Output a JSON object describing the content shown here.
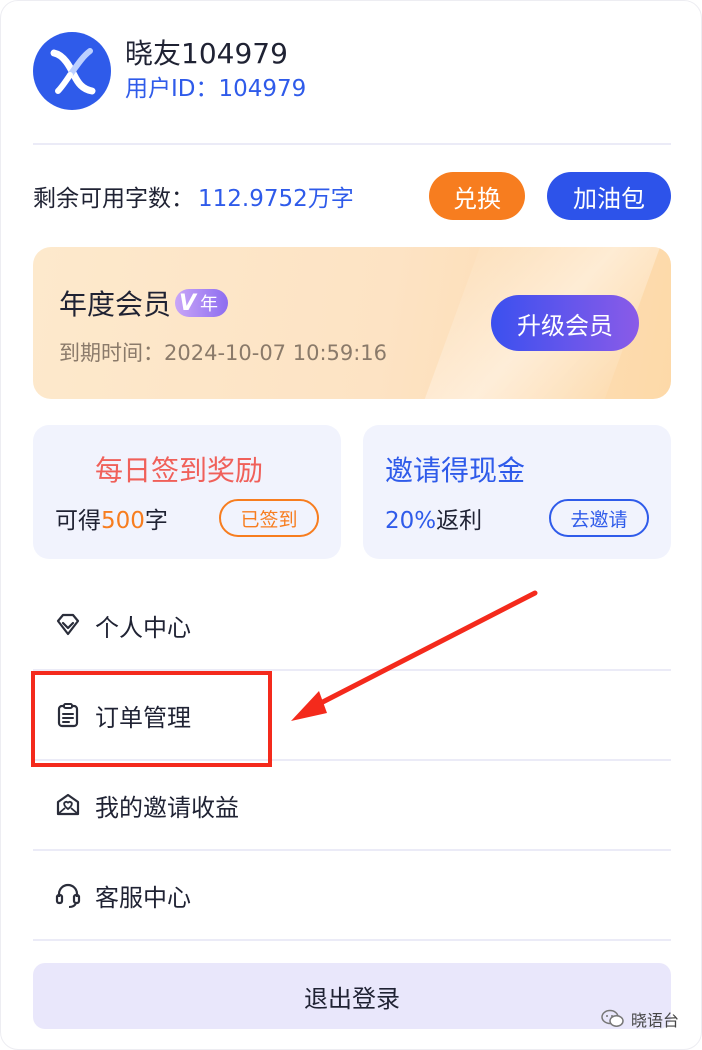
{
  "user": {
    "name": "晓友104979",
    "id_text": "用户ID：104979"
  },
  "balance": {
    "label": "剩余可用字数：",
    "value": "112.9752万字",
    "redeem_label": "兑换",
    "topup_label": "加油包"
  },
  "membership": {
    "title": "年度会员",
    "badge_v": "V",
    "badge_text": "年",
    "expire": "到期时间：2024-10-07 10:59:16",
    "upgrade_label": "升级会员"
  },
  "checkin": {
    "title": "每日签到奖励",
    "sub_prefix": "可得",
    "sub_amount": "500",
    "sub_suffix": "字",
    "status_label": "已签到"
  },
  "invite": {
    "title": "邀请得现金",
    "sub_percent": "20%",
    "sub_suffix": "返利",
    "action_label": "去邀请"
  },
  "menu": [
    {
      "label": "个人中心",
      "icon": "diamond-icon"
    },
    {
      "label": "订单管理",
      "icon": "clipboard-icon"
    },
    {
      "label": "我的邀请收益",
      "icon": "envelope-heart-icon"
    },
    {
      "label": "客服中心",
      "icon": "headset-icon"
    }
  ],
  "logout_label": "退出登录",
  "watermark": "晓语台",
  "colors": {
    "brand_blue": "#2f5bea",
    "orange": "#f77d1f",
    "annotation_red": "#f42a1c"
  }
}
